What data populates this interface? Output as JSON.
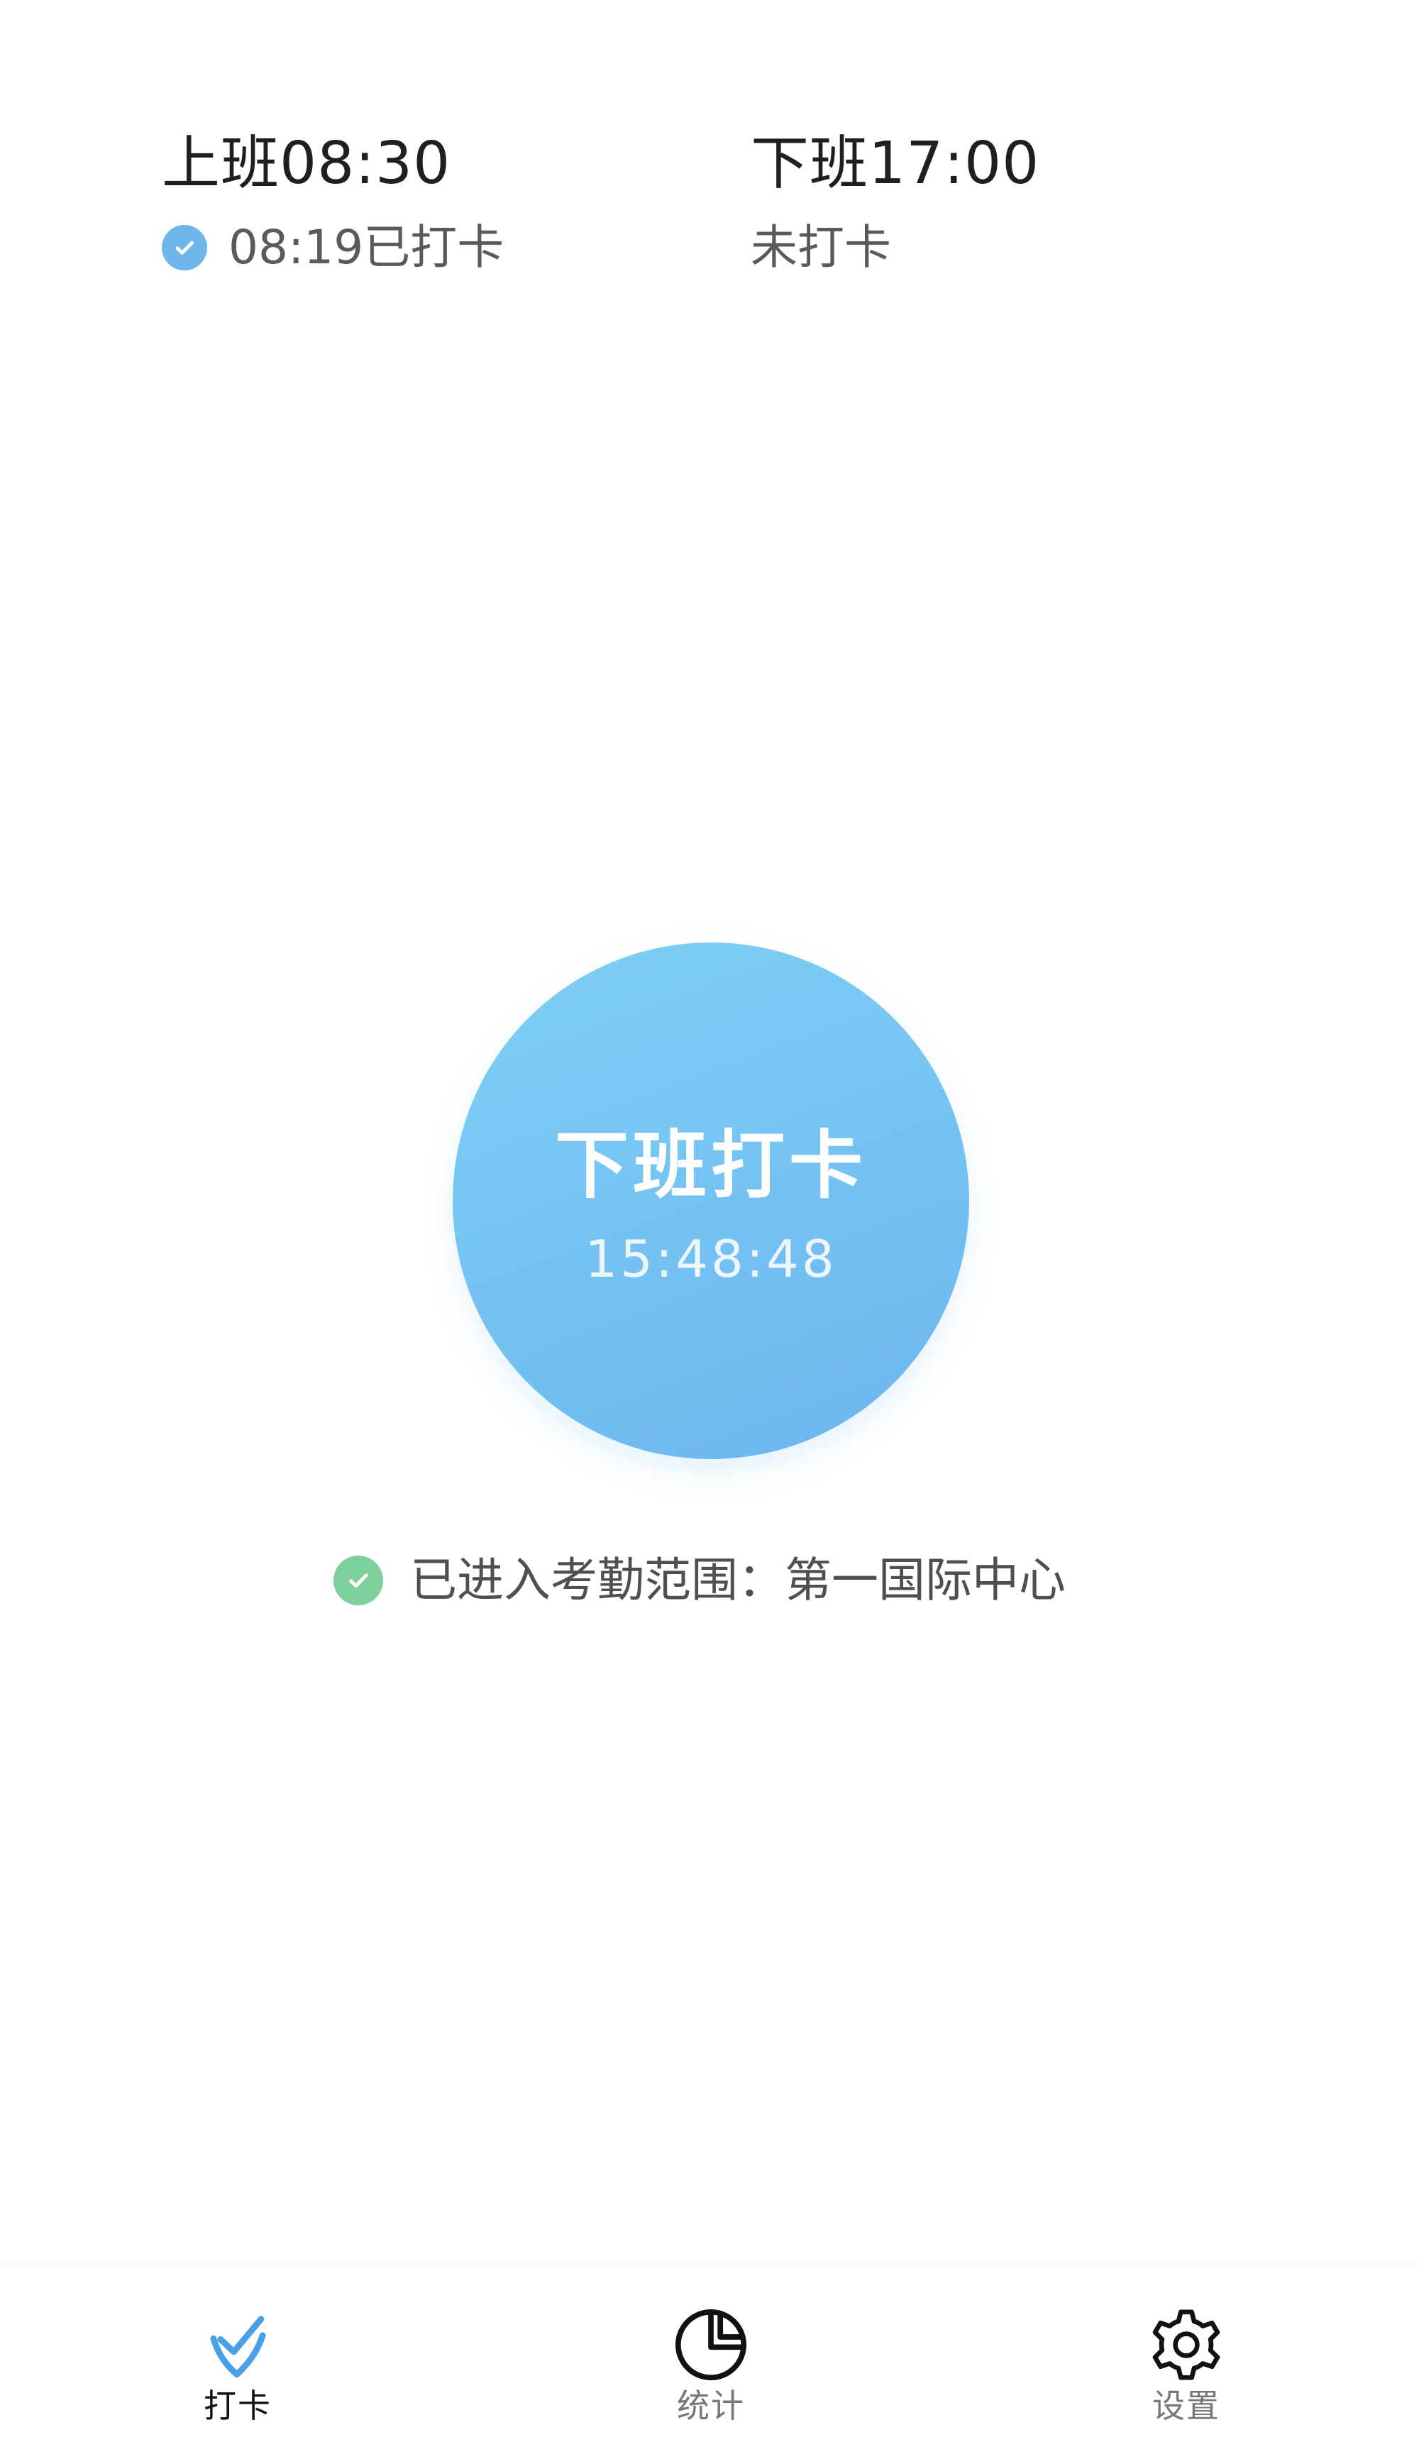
{
  "schedule": {
    "start": {
      "title": "上班08:30",
      "status": "08:19已打卡"
    },
    "end": {
      "title": "下班17:00",
      "status": "未打卡"
    }
  },
  "punch": {
    "label": "下班打卡",
    "time": "15:48:48"
  },
  "range": {
    "status": "已进入考勤范围：第一国际中心"
  },
  "tabs": [
    {
      "label": "打卡",
      "icon": "check-shield-icon",
      "active": true
    },
    {
      "label": "统计",
      "icon": "pie-chart-icon",
      "active": false
    },
    {
      "label": "设置",
      "icon": "gear-icon",
      "active": false
    }
  ],
  "colors": {
    "primary": "#6cb5ef",
    "success": "#7ed09b",
    "text": "#1f1f1f",
    "muted": "#5a5a5a"
  }
}
